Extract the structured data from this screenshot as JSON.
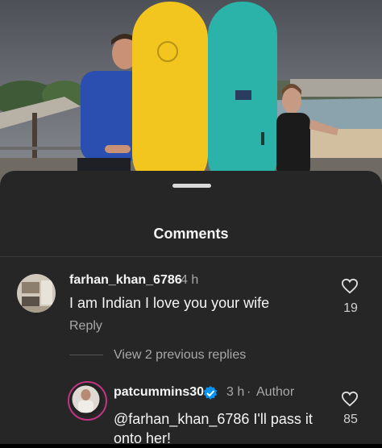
{
  "photo": {
    "description_icon": "surfboards-photo"
  },
  "comments_sheet": {
    "title": "Comments",
    "comment1": {
      "username": "farhan_khan_6786",
      "time": "4 h",
      "text": "I am Indian I love you your wife",
      "reply_label": "Reply",
      "likes": "19"
    },
    "view_replies": "View 2 previous replies",
    "comment2": {
      "username": "patcummins30",
      "time": "3 h",
      "separator": "·",
      "author_badge": "Author",
      "text_line1": "@farhan_khan_6786 I'll pass it",
      "text_line2": "onto her!",
      "likes": "85"
    }
  },
  "colors": {
    "sheet_bg": "#262626",
    "verified_blue": "#0095f6",
    "yellow_board": "#f2c61f",
    "teal_board": "#2cb3a9"
  }
}
